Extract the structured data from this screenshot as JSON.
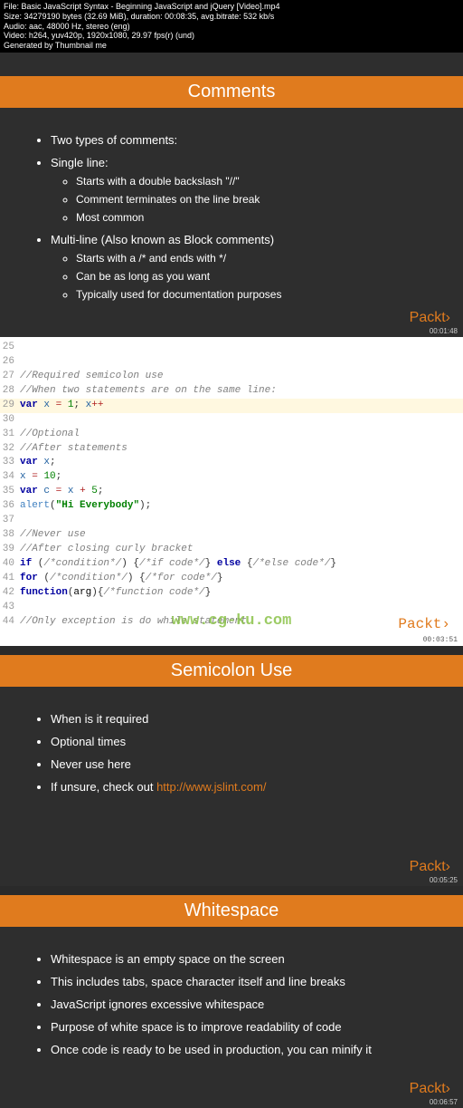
{
  "meta": {
    "file": "File: Basic JavaScript Syntax - Beginning JavaScript and jQuery [Video].mp4",
    "size": "Size: 34279190 bytes (32.69 MiB), duration: 00:08:35, avg.bitrate: 532 kb/s",
    "audio": "Audio: aac, 48000 Hz, stereo (eng)",
    "video": "Video: h264, yuv420p, 1920x1080, 29.97 fps(r) (und)",
    "gen": "Generated by Thumbnail me"
  },
  "logo": "Packt›",
  "watermark": "www.cg-ku.com",
  "slide1": {
    "title": "Comments",
    "items": [
      {
        "text": "Two types of comments:"
      },
      {
        "text": "Single line:",
        "sub": [
          "Starts with a double backslash \"//\"",
          "Comment terminates on the line break",
          "Most common"
        ]
      },
      {
        "text": "Multi-line (Also known as Block comments)",
        "sub": [
          "Starts with a /* and ends with */",
          "Can be as long as you want",
          "Typically used for documentation purposes"
        ]
      }
    ],
    "timestamp": "00:01:48"
  },
  "code": {
    "lines": [
      {
        "n": 25,
        "t": ""
      },
      {
        "n": 26,
        "t": ""
      },
      {
        "n": 27,
        "t": "//Required semicolon use",
        "cls": "comment"
      },
      {
        "n": 28,
        "t": "//When two statements are on the same line:",
        "cls": "comment"
      },
      {
        "n": 29,
        "raw": true,
        "hl": true
      },
      {
        "n": 30,
        "t": ""
      },
      {
        "n": 31,
        "t": "//Optional",
        "cls": "comment"
      },
      {
        "n": 32,
        "t": "//After statements",
        "cls": "comment"
      },
      {
        "n": 33,
        "raw": "var_x"
      },
      {
        "n": 34,
        "raw": "x_10"
      },
      {
        "n": 35,
        "raw": "var_c"
      },
      {
        "n": 36,
        "raw": "alert"
      },
      {
        "n": 37,
        "t": ""
      },
      {
        "n": 38,
        "t": "//Never use",
        "cls": "comment"
      },
      {
        "n": 39,
        "t": "//After closing curly bracket",
        "cls": "comment"
      },
      {
        "n": 40,
        "raw": "if_else"
      },
      {
        "n": 41,
        "raw": "for"
      },
      {
        "n": 42,
        "raw": "function"
      },
      {
        "n": 43,
        "t": ""
      },
      {
        "n": 44,
        "t": "//Only exception is do while statement",
        "cls": "comment"
      }
    ],
    "timestamp": "00:03:51"
  },
  "slide2": {
    "title": "Semicolon Use",
    "items": [
      "When is it required",
      "Optional times",
      "Never use here"
    ],
    "link_prefix": "If unsure, check out ",
    "link_text": "http://www.jslint.com/",
    "timestamp": "00:05:25"
  },
  "slide3": {
    "title": "Whitespace",
    "items": [
      "Whitespace is an empty space on the screen",
      "This includes tabs, space character itself and line breaks",
      "JavaScript ignores excessive whitespace",
      "Purpose of white space is to improve readability of code",
      "Once code is ready to be used in production, you can minify it"
    ],
    "timestamp": "00:06:57"
  }
}
